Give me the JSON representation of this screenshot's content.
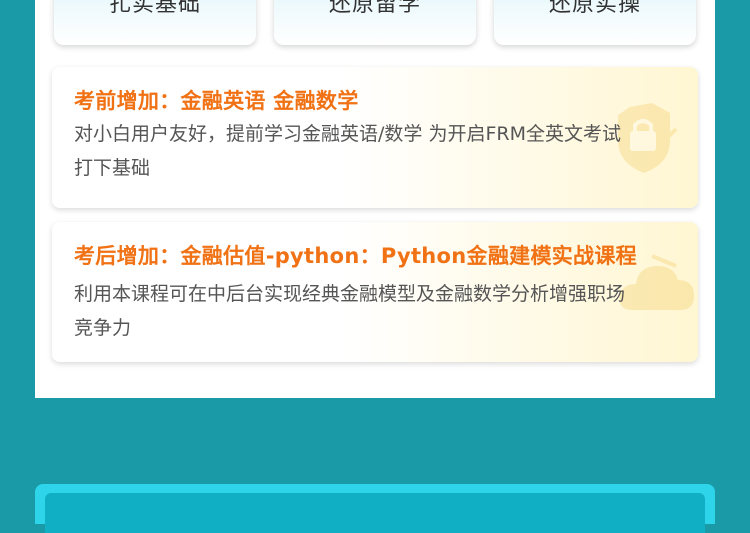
{
  "top_cards": [
    {
      "label": "扎实基础"
    },
    {
      "label": "还原留学"
    },
    {
      "label": "还原实操"
    }
  ],
  "cards": [
    {
      "title": "考前增加：金融英语 金融数学",
      "description": "对小白用户友好，提前学习金融英语/数学 为开启FRM全英文考试打下基础",
      "icon": "lock-icon"
    },
    {
      "title": "考后增加：金融估值-python：Python金融建模实战课程",
      "description": "利用本课程可在中后台实现经典金融模型及金融数学分析增强职场竞争力",
      "icon": "cloud-icon"
    }
  ]
}
